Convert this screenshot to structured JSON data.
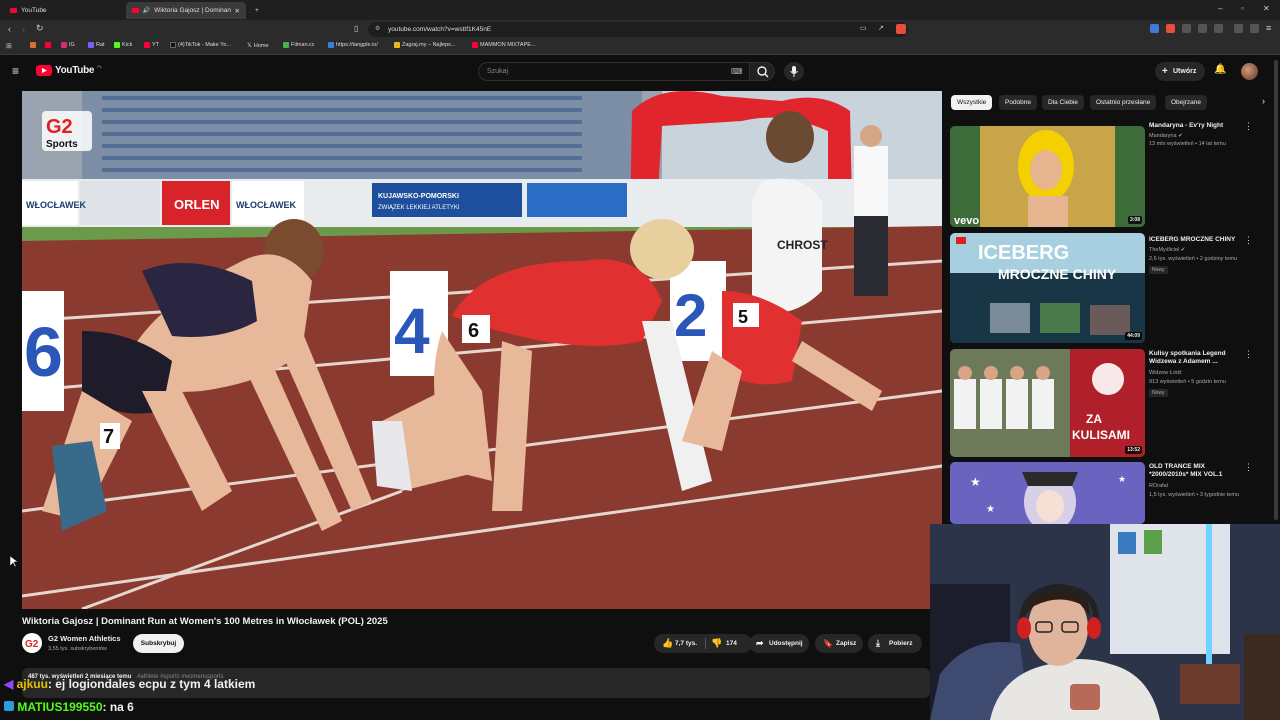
{
  "tabs": [
    {
      "label": "YouTube",
      "active": false
    },
    {
      "label": "Wiktoria Gajosz | Dominant R",
      "active": true
    }
  ],
  "address": {
    "url": "youtube.com/watch?v=wsttf1K45nE"
  },
  "bookmarks": [
    {
      "label": "",
      "color": "#e06c2a"
    },
    {
      "label": "",
      "color": "#ff0033"
    },
    {
      "label": "IG",
      "color": "#d62976"
    },
    {
      "label": "Rat",
      "color": "#7a5cff"
    },
    {
      "label": "Kick",
      "color": "#53fc18"
    },
    {
      "label": "YT",
      "color": "#ff0033"
    },
    {
      "label": "(4)TikTok - Make Yo...",
      "color": "#000000"
    },
    {
      "label": "Home",
      "color": "#ffffff"
    },
    {
      "label": "Filman.cc",
      "color": "#4caf50"
    },
    {
      "label": "https://tangple.io/",
      "color": "#3f7bd9"
    },
    {
      "label": "Zagraj.my – Najleps...",
      "color": "#e8b923"
    },
    {
      "label": "MAMMON MIXTAPE...",
      "color": "#ff0033"
    }
  ],
  "youtube": {
    "logo_text": "YouTube",
    "region": "PL",
    "search_placeholder": "Szukaj",
    "create_label": "Utwórz"
  },
  "video": {
    "title": "Wiktoria Gajosz | Dominant Run at Women's 100 Metres in Włocławek (POL) 2025",
    "watermark": "G2 Sports",
    "channel": "G2 Women Athletics",
    "subscribers": "3,55 tys. subskrybentów",
    "subscribe_label": "Subskrybuj",
    "likes": "7,7 tys.",
    "dislikes": "174",
    "share_label": "Udostępnij",
    "save_label": "Zapisz",
    "download_label": "Pobierz",
    "views": "487 tys. wyświetleń  2 miesiące temu",
    "hashtags": "#athlete #sports #womenssports",
    "banners": [
      "WŁOCŁAWEK",
      "ORLEN",
      "WŁOCŁAWEK",
      "KUJAWSKO-POMORSKI ZWIĄZEK LEKKIEJ ATLETYKI",
      "ORLEN"
    ],
    "bib_numbers": [
      "7",
      "6",
      "5",
      "CHROST"
    ],
    "lane_numbers": [
      "6",
      "4",
      "2"
    ]
  },
  "chips": [
    {
      "label": "Wszystkie",
      "selected": true
    },
    {
      "label": "Podobne",
      "selected": false
    },
    {
      "label": "Dla Ciebie",
      "selected": false
    },
    {
      "label": "Ostatnio przesłane",
      "selected": false
    },
    {
      "label": "Obejrzane",
      "selected": false
    }
  ],
  "recommendations": [
    {
      "title": "Mandaryna - Ev'ry Night",
      "channel": "Mandaryna",
      "meta": "13 mln wyświetleń • 14 lat temu",
      "duration": "3:08",
      "badge": "",
      "thumb_text": "vevo"
    },
    {
      "title": "ICEBERG MROCZNE CHINY",
      "channel": "TheMyśliciel",
      "meta": "2,6 tys. wyświetleń • 2 godziny temu",
      "duration": "44:09",
      "badge": "Nowy",
      "thumb_text": "ICEBERG MROCZNE CHINY"
    },
    {
      "title": "Kulisy spotkania Legend Widzewa z Adamem ...",
      "channel": "Widzew Łódź",
      "meta": "913 wyświetleń • 5 godzin temu",
      "duration": "13:52",
      "badge": "Nowy",
      "thumb_text": "ZA KULISAMI"
    },
    {
      "title": "OLD TRANCE MIX *2000/2010s* MIX VOL.1",
      "channel": "ROrafal",
      "meta": "1,5 tys. wyświetleń • 3 tygodnie temu",
      "duration": "",
      "badge": "",
      "thumb_text": ""
    }
  ],
  "chat": [
    {
      "user": "ajkuu",
      "text": ": ej logiondales ecpu z tym 4 latkiem"
    },
    {
      "user": "MATIUS199550",
      "text": ": na 6"
    }
  ],
  "colors": {
    "accent": "#ff0033",
    "chat_user": "#53fc18",
    "track": "#8a3a2e"
  }
}
